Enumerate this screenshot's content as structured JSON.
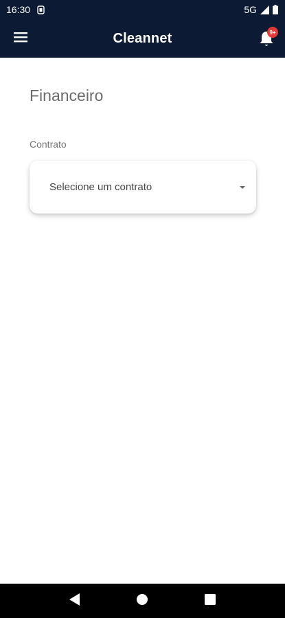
{
  "status_bar": {
    "time": "16:30",
    "network": "5G",
    "icons": [
      "sim-icon",
      "signal-icon",
      "battery-icon"
    ]
  },
  "app_bar": {
    "title": "Cleannet",
    "notification_badge": "9+",
    "icons": [
      "menu-icon",
      "bell-icon"
    ]
  },
  "page": {
    "title": "Financeiro",
    "contract_label": "Contrato",
    "contract_select_placeholder": "Selecione um contrato"
  },
  "nav_bar": {
    "icons": [
      "back-icon",
      "home-icon",
      "recents-icon"
    ]
  },
  "colors": {
    "app_bar_bg": "#0c1a33",
    "badge": "#e53935",
    "background": "#ffffff"
  }
}
